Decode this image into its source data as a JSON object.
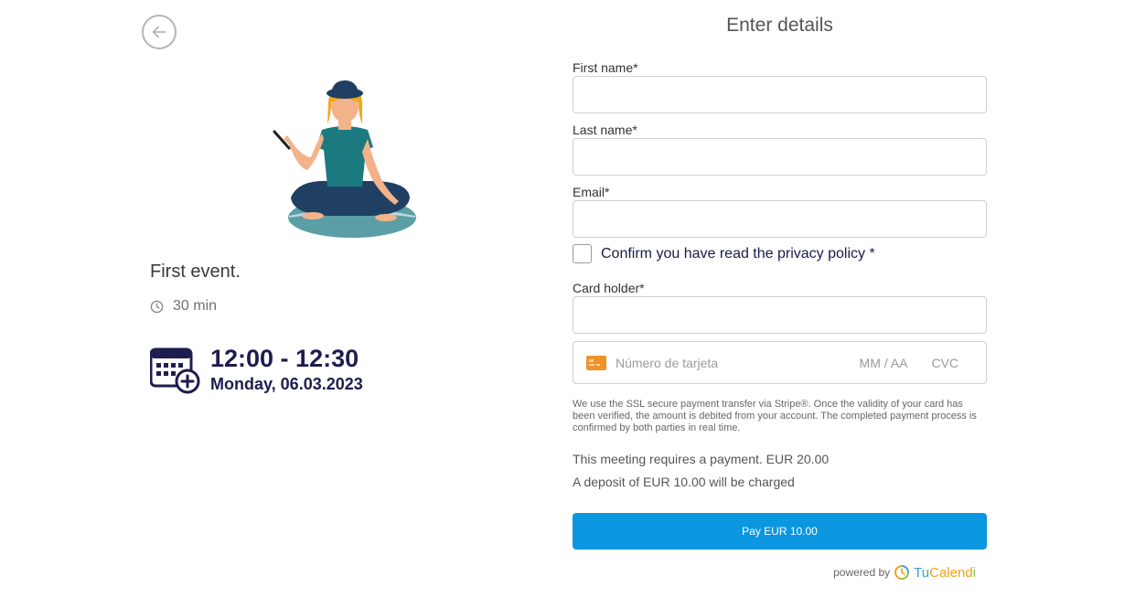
{
  "nav": {
    "back_icon": "arrow-left-circle-icon"
  },
  "event": {
    "title": "First event.",
    "duration": "30 min",
    "time_range": "12:00 - 12:30",
    "date": "Monday, 06.03.2023",
    "calendar_icon": "calendar-add-icon",
    "clock_icon": "clock-icon"
  },
  "form": {
    "title": "Enter details",
    "first_name_label": "First name*",
    "last_name_label": "Last name*",
    "email_label": "Email*",
    "first_name_value": "",
    "last_name_value": "",
    "email_value": "",
    "privacy_label": "Confirm you have read the privacy policy *",
    "card_holder_label": "Card holder*",
    "card_holder_value": "",
    "card_number_placeholder": "Número de tarjeta",
    "card_exp_placeholder": "MM / AA",
    "card_cvc_placeholder": "CVC",
    "ssl_note": "We use the SSL secure payment transfer via Stripe®. Once the validity of your card has been verified, the amount is debited from your account. The completed payment process is confirmed by both parties in real time.",
    "payment_required": "This meeting requires a payment. EUR 20.00",
    "deposit": "A deposit of EUR 10.00 will be charged",
    "pay_button": "Pay EUR 10.00"
  },
  "footer": {
    "powered_by": "powered by",
    "brand_tu": "Tu",
    "brand_cal": "Calend",
    "brand_i": "i"
  },
  "colors": {
    "accent": "#0b96e0",
    "navy": "#1d1d4f",
    "card_icon": "#f0932b"
  }
}
